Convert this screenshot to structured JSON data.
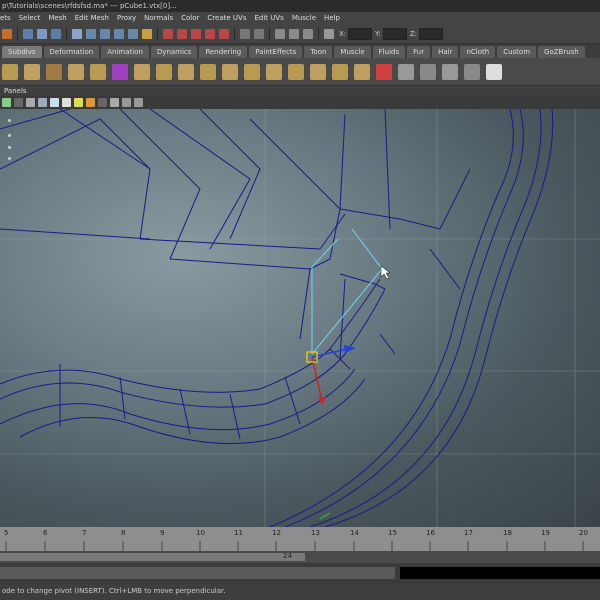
{
  "window": {
    "title": "p\\Tutorials\\scenes\\rfdsfsd.ma*    ---    pCube1.vtx[0]..."
  },
  "menubar": {
    "items": [
      "ets",
      "Select",
      "Mesh",
      "Edit Mesh",
      "Proxy",
      "Normals",
      "Color",
      "Create UVs",
      "Edit UVs",
      "Muscle",
      "Help"
    ]
  },
  "statusline": {
    "x_label": "X:",
    "y_label": "Y:",
    "z_label": "Z:"
  },
  "shelf_tabs": {
    "items": [
      "Subdivs",
      "Deformation",
      "Animation",
      "Dynamics",
      "Rendering",
      "PaintEffects",
      "Toon",
      "Muscle",
      "Fluids",
      "Fur",
      "Hair",
      "nCloth",
      "Custom",
      "GoZBrush"
    ],
    "active": "Subdivs"
  },
  "shelf": {
    "icon_names": [
      "smooth-icon",
      "cube-mesh-icon",
      "wrap-icon",
      "combine-icon",
      "extract-icon",
      "purple-cube-icon",
      "plane-icon",
      "bevel-icon",
      "poke-icon",
      "wedge-icon",
      "extrude-face-icon",
      "merge-icon",
      "bridge-icon",
      "append-icon",
      "split-icon",
      "insert-loop-icon",
      "offset-loop-icon",
      "slide-edge-icon",
      "triangulate-icon",
      "quadrangulate-icon",
      "checker-icon",
      "checker-icon",
      "checker-icon",
      "checker-icon",
      "checker-icon",
      "checker-icon",
      "checker-icon"
    ]
  },
  "viewport": {
    "panels_label": "Panels"
  },
  "timeline": {
    "ticks": [
      "5",
      "6",
      "7",
      "8",
      "9",
      "10",
      "11",
      "12",
      "13",
      "14",
      "15",
      "16",
      "17",
      "18",
      "19",
      "20"
    ],
    "current_frame": "24"
  },
  "helpline": {
    "text": "ode to change pivot (INSERT).  Ctrl+LMB to move perpendicular."
  },
  "colors": {
    "wireframe": "#1a1a8a",
    "selected_wire": "#6ec8e6",
    "manip_y": "#cc2222",
    "manip_x": "#2244dd",
    "manip_center": "#eecc00"
  }
}
